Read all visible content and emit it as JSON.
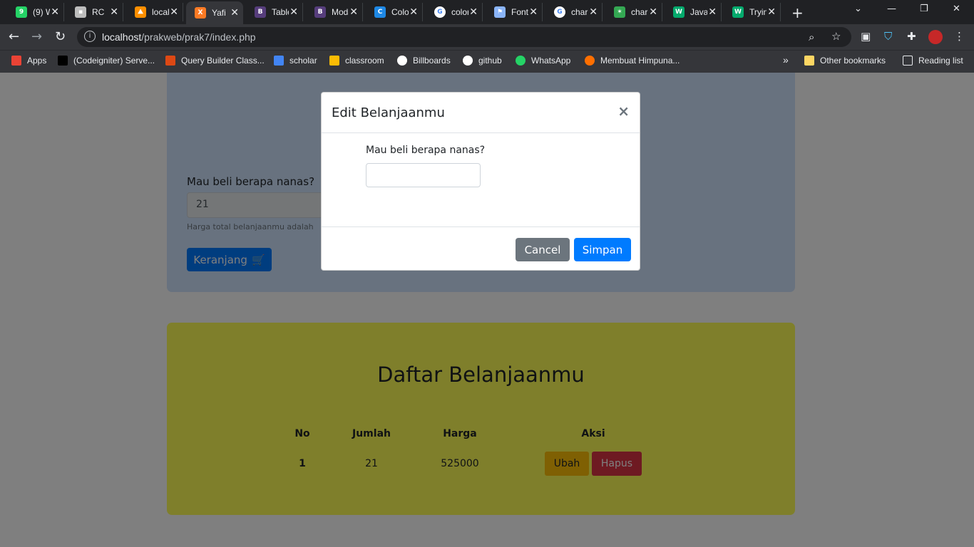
{
  "browser": {
    "tabs": [
      {
        "title": "(9) W",
        "favicon": "whatsapp-icon",
        "color": "#25d366",
        "glyph": "9"
      },
      {
        "title": "RC",
        "favicon": "rc-icon",
        "color": "#bdbdbd",
        "glyph": "▪"
      },
      {
        "title": "localhost",
        "favicon": "codeigniter-icon",
        "color": "#ff8f00",
        "glyph": "⛰"
      },
      {
        "title": "Yafi",
        "favicon": "xampp-icon",
        "color": "#fb7a24",
        "glyph": "X",
        "active": true
      },
      {
        "title": "Table",
        "favicon": "bootstrap-icon",
        "color": "#563d7c",
        "glyph": "B"
      },
      {
        "title": "Modal",
        "favicon": "bootstrap-icon",
        "color": "#563d7c",
        "glyph": "B"
      },
      {
        "title": "Colors",
        "favicon": "canva-icon",
        "color": "#1e88e5",
        "glyph": "C"
      },
      {
        "title": "color",
        "favicon": "google-icon",
        "color": "#ffffff",
        "glyph": "G"
      },
      {
        "title": "Font",
        "favicon": "flag-icon",
        "color": "#8ab4f8",
        "glyph": "⚑"
      },
      {
        "title": "char",
        "favicon": "google-icon",
        "color": "#ffffff",
        "glyph": "G"
      },
      {
        "title": "char",
        "favicon": "pinwheel-icon",
        "color": "#34a853",
        "glyph": "✶"
      },
      {
        "title": "Java",
        "favicon": "w3schools-icon",
        "color": "#04aa6d",
        "glyph": "W"
      },
      {
        "title": "Trying",
        "favicon": "w3schools-icon",
        "color": "#04aa6d",
        "glyph": "W"
      }
    ],
    "url_host": "localhost",
    "url_path": "/prakweb/prak7/index.php",
    "bookmarks": [
      {
        "label": "Apps",
        "icon": "apps-grid-icon",
        "color": "#ea4335"
      },
      {
        "label": "(Codeigniter) Serve...",
        "icon": "code-icon",
        "color": "#000000"
      },
      {
        "label": "Query Builder Class...",
        "icon": "codeigniter-icon",
        "color": "#dd4814"
      },
      {
        "label": "scholar",
        "icon": "scholar-icon",
        "color": "#4285f4"
      },
      {
        "label": "classroom",
        "icon": "classroom-icon",
        "color": "#fbbc04"
      },
      {
        "label": "Billboards",
        "icon": "globe-icon",
        "color": "#ffffff"
      },
      {
        "label": "github",
        "icon": "github-icon",
        "color": "#ffffff"
      },
      {
        "label": "WhatsApp",
        "icon": "whatsapp-icon",
        "color": "#25d366"
      },
      {
        "label": "Membuat Himpuna...",
        "icon": "ball-icon",
        "color": "#ff6f00"
      }
    ],
    "other_bookmarks": "Other bookmarks",
    "reading_list": "Reading list",
    "overflow": "»"
  },
  "form": {
    "label": "Mau beli berapa nanas?",
    "value": "21",
    "help": "Harga total belanjaanmu adalah",
    "submit_label": "Keranjang"
  },
  "list": {
    "title": "Daftar Belanjaanmu",
    "columns": [
      "No",
      "Jumlah",
      "Harga",
      "Aksi"
    ],
    "rows": [
      {
        "no": "1",
        "jumlah": "21",
        "harga": "525000",
        "edit": "Ubah",
        "delete": "Hapus"
      }
    ]
  },
  "modal": {
    "title": "Edit Belanjaanmu",
    "close": "×",
    "label": "Mau beli berapa nanas?",
    "value": "",
    "cancel": "Cancel",
    "save": "Simpan"
  }
}
